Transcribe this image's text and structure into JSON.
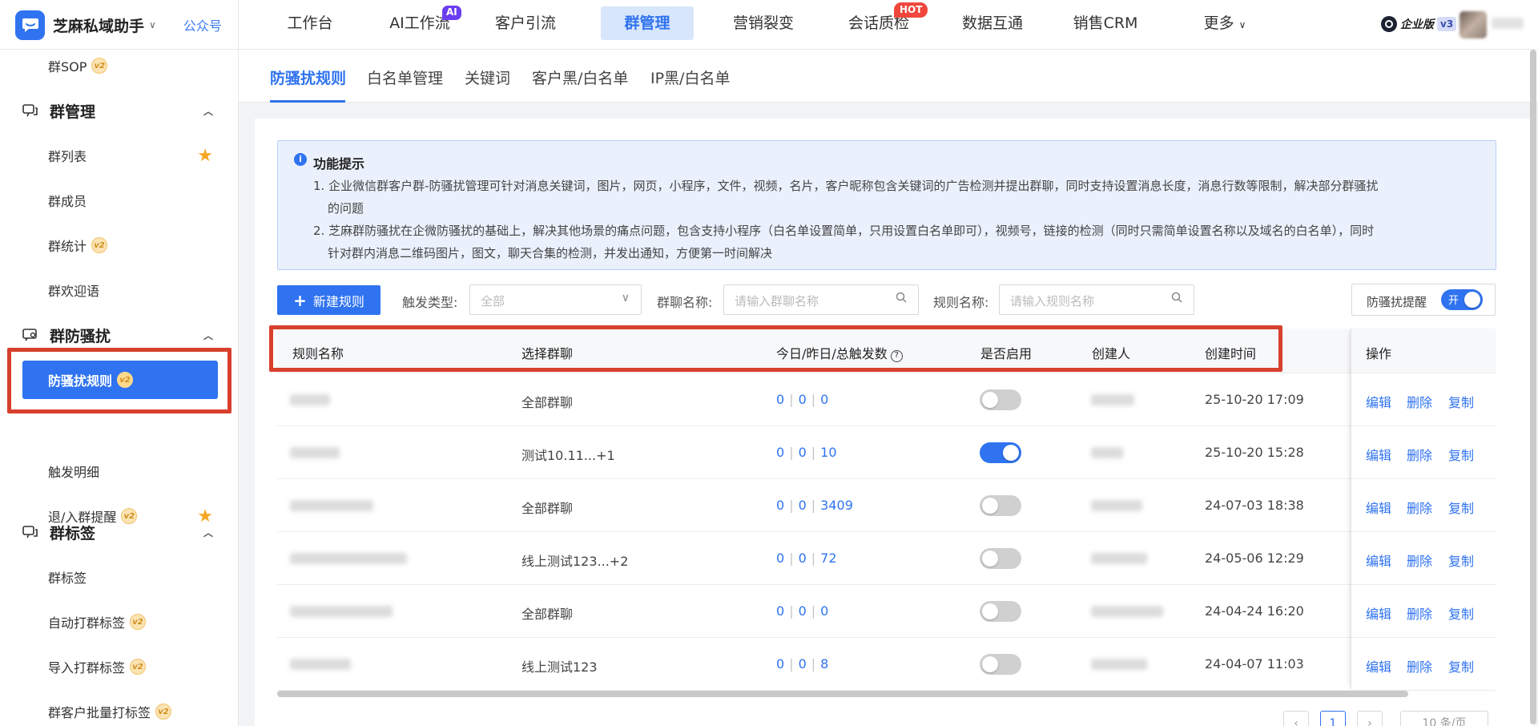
{
  "brand": {
    "name": "芝麻私域助手",
    "caret": "∨",
    "wechat": "公众号"
  },
  "nav": {
    "items": [
      "工作台",
      "AI工作流",
      "客户引流",
      "群管理",
      "营销裂变",
      "会话质检",
      "数据互通",
      "销售CRM",
      "更多"
    ],
    "ai_badge": "AI",
    "hot_badge": "HOT",
    "more_caret": "∨",
    "edition": "企业版",
    "edition_level": "v3"
  },
  "sidebar": {
    "sop": "群SOP",
    "group_manage": "群管理",
    "group_list": "群列表",
    "group_members": "群成员",
    "group_stats": "群统计",
    "group_welcome": "群欢迎语",
    "anti_harass": "群防骚扰",
    "anti_rules": "防骚扰规则",
    "trigger_detail": "触发明细",
    "leave_join": "退/入群提醒",
    "group_tags": "群标签",
    "tags": "群标签",
    "auto_tag": "自动打群标签",
    "import_tag": "导入打群标签",
    "batch_tag": "群客户批量打标签",
    "v2": "v2"
  },
  "tabs": [
    "防骚扰规则",
    "白名单管理",
    "关键词",
    "客户黑/白名单",
    "IP黑/白名单"
  ],
  "notice": {
    "title": "功能提示",
    "p1_line1": "1. 企业微信群客户群-防骚扰管理可针对消息关键词，图片，网页，小程序，文件，视频，名片，客户昵称包含关键词的广告检测并提出群聊，同时支持设置消息长度，消息行数等限制，解决部分群骚扰",
    "p1_line2": "的问题",
    "p2_line1": "2. 芝麻群防骚扰在企微防骚扰的基础上，解决其他场景的痛点问题，包含支持小程序（白名单设置简单，只用设置白名单即可），视频号，链接的检测（同时只需简单设置名称以及域名的白名单），同时",
    "p2_line2": "针对群内消息二维码图片，图文，聊天合集的检测，并发出通知，方便第一时间解决"
  },
  "toolbar": {
    "new_rule": "新建规则",
    "trigger_type_label": "触发类型:",
    "trigger_type_value": "全部",
    "chat_name_label": "群聊名称:",
    "chat_name_placeholder": "请输入群聊名称",
    "rule_name_label": "规则名称:",
    "rule_name_placeholder": "请输入规则名称",
    "reminder_label": "防骚扰提醒",
    "reminder_state": "开"
  },
  "table": {
    "headers": [
      "规则名称",
      "选择群聊",
      "今日/昨日/总触发数",
      "是否启用",
      "创建人",
      "创建时间",
      "操作"
    ],
    "actions": [
      "编辑",
      "删除",
      "复制"
    ],
    "rows": [
      {
        "chat": "全部群聊",
        "today": "0",
        "yesterday": "0",
        "total": "0",
        "enabled": false,
        "time": "25-10-20 17:09"
      },
      {
        "chat": "测试10.11...+1",
        "today": "0",
        "yesterday": "0",
        "total": "10",
        "enabled": true,
        "time": "25-10-20 15:28"
      },
      {
        "chat": "全部群聊",
        "today": "0",
        "yesterday": "0",
        "total": "3409",
        "enabled": false,
        "time": "24-07-03 18:38"
      },
      {
        "chat": "线上测试123...+2",
        "today": "0",
        "yesterday": "0",
        "total": "72",
        "enabled": false,
        "time": "24-05-06 12:29"
      },
      {
        "chat": "全部群聊",
        "today": "0",
        "yesterday": "0",
        "total": "0",
        "enabled": false,
        "time": "24-04-24 16:20"
      },
      {
        "chat": "线上测试123",
        "today": "0",
        "yesterday": "0",
        "total": "8",
        "enabled": false,
        "time": "24-04-07 11:03"
      }
    ]
  },
  "pagination": {
    "current": "1",
    "page_size": "10 条/页"
  },
  "colors": {
    "accent": "#2f73f0",
    "highlight": "#d7402c",
    "star": "#f6a623"
  }
}
